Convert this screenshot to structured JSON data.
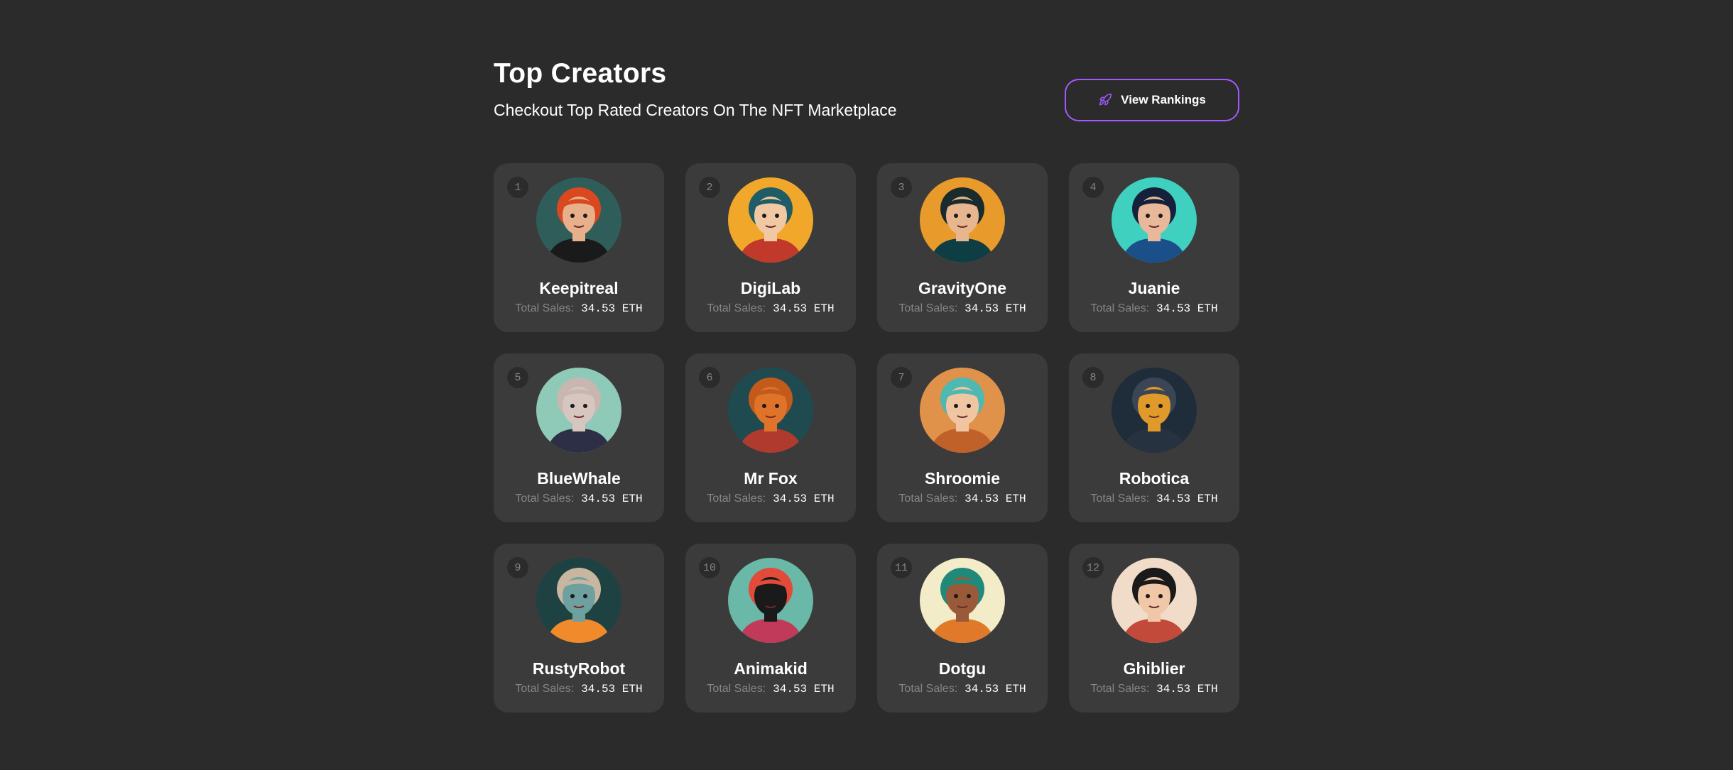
{
  "header": {
    "title": "Top Creators",
    "subtitle": "Checkout Top Rated Creators On The NFT Marketplace",
    "button_label": "View Rankings",
    "button_icon": "rocket-icon",
    "accent": "#a259ff"
  },
  "colors": {
    "background": "#2b2b2b",
    "card": "#3b3b3b",
    "muted": "#858584"
  },
  "creators": [
    {
      "rank": "1",
      "name": "Keepitreal",
      "sales_label": "Total Sales:",
      "sales": "34.53 ETH",
      "bg": "#2f5d5a",
      "skin": "#e8b08a",
      "hair": "#d9481f",
      "accent": "#1a1a1a"
    },
    {
      "rank": "2",
      "name": "DigiLab",
      "sales_label": "Total Sales:",
      "sales": "34.53 ETH",
      "bg": "#f0a72a",
      "skin": "#f0c9a4",
      "hair": "#1f5c66",
      "accent": "#c0392b"
    },
    {
      "rank": "3",
      "name": "GravityOne",
      "sales_label": "Total Sales:",
      "sales": "34.53 ETH",
      "bg": "#e89b2a",
      "skin": "#e7b58e",
      "hair": "#1a2b2e",
      "accent": "#0f3d44"
    },
    {
      "rank": "4",
      "name": "Juanie",
      "sales_label": "Total Sales:",
      "sales": "34.53 ETH",
      "bg": "#3fd0c0",
      "skin": "#e8b89a",
      "hair": "#15203a",
      "accent": "#1b4f8a"
    },
    {
      "rank": "5",
      "name": "BlueWhale",
      "sales_label": "Total Sales:",
      "sales": "34.53 ETH",
      "bg": "#8fc9b8",
      "skin": "#d7c6c0",
      "hair": "#c8b6b0",
      "accent": "#2c2f45"
    },
    {
      "rank": "6",
      "name": "Mr Fox",
      "sales_label": "Total Sales:",
      "sales": "34.53 ETH",
      "bg": "#1e4a50",
      "skin": "#e0732a",
      "hair": "#c25a1c",
      "accent": "#b03a2e"
    },
    {
      "rank": "7",
      "name": "Shroomie",
      "sales_label": "Total Sales:",
      "sales": "34.53 ETH",
      "bg": "#e0924a",
      "skin": "#f0c6a2",
      "hair": "#4fb8b0",
      "accent": "#c0612a"
    },
    {
      "rank": "8",
      "name": "Robotica",
      "sales_label": "Total Sales:",
      "sales": "34.53 ETH",
      "bg": "#1f2d3a",
      "skin": "#e09a2a",
      "hair": "#3a4656",
      "accent": "#26323f"
    },
    {
      "rank": "9",
      "name": "RustyRobot",
      "sales_label": "Total Sales:",
      "sales": "34.53 ETH",
      "bg": "#1e4242",
      "skin": "#6fa0a0",
      "hair": "#c9b6a0",
      "accent": "#f08a2a"
    },
    {
      "rank": "10",
      "name": "Animakid",
      "sales_label": "Total Sales:",
      "sales": "34.53 ETH",
      "bg": "#6ab8a8",
      "skin": "#1a1a1a",
      "hair": "#e24a3a",
      "accent": "#c23a5a"
    },
    {
      "rank": "11",
      "name": "Dotgu",
      "sales_label": "Total Sales:",
      "sales": "34.53 ETH",
      "bg": "#f2ecc8",
      "skin": "#9a5a3a",
      "hair": "#1f8a7a",
      "accent": "#e07a2a"
    },
    {
      "rank": "12",
      "name": "Ghiblier",
      "sales_label": "Total Sales:",
      "sales": "34.53 ETH",
      "bg": "#f0dcc8",
      "skin": "#f0c8a8",
      "hair": "#1a1a1a",
      "accent": "#c24a3a"
    }
  ]
}
